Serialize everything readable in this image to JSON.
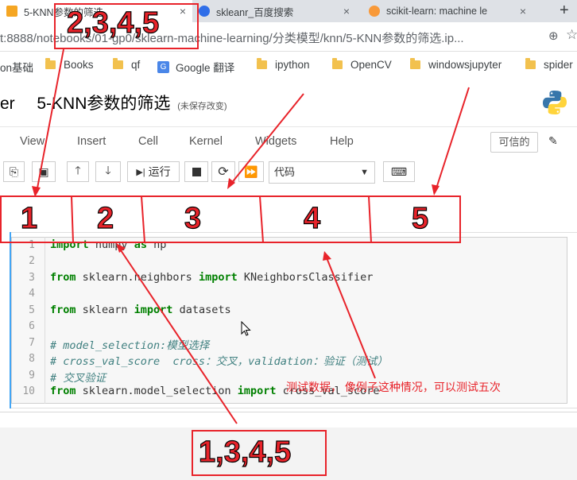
{
  "browser": {
    "tabs": [
      {
        "label": "5-KNN参数的筛选",
        "close": "×"
      },
      {
        "label": "skleanr_百度搜索",
        "close": "×"
      },
      {
        "label": "scikit-learn: machine le",
        "close": "×"
      }
    ],
    "new_tab": "+",
    "url": "t:8888/notebooks/01-gp0/sklearn-machine-learning/分类模型/knn/5-KNN参数的筛选.ip...",
    "bookmarks": [
      "on基础",
      "Books",
      "qf",
      "Google 翻译",
      "ipython",
      "OpenCV",
      "windowsjupyter",
      "spider"
    ]
  },
  "jupyter": {
    "logo_suffix": "er",
    "notebook_name": "5-KNN参数的筛选",
    "save_status": "(未保存改变)",
    "menu": [
      "View",
      "Insert",
      "Cell",
      "Kernel",
      "Widgets",
      "Help"
    ],
    "trusted": "可信的",
    "run_label": "运行",
    "cell_type": "代码"
  },
  "code": {
    "line_numbers": [
      "1",
      "2",
      "3",
      "4",
      "5",
      "6",
      "7",
      "8",
      "9",
      "10"
    ],
    "lines": [
      {
        "kw1": "import",
        "mid": " numpy ",
        "kw2": "as",
        "tail": " np"
      },
      {},
      {
        "kw1": "from",
        "mid": " sklearn.neighbors ",
        "kw2": "import",
        "tail": " KNeighborsClassifier"
      },
      {},
      {
        "kw1": "from",
        "mid": " sklearn ",
        "kw2": "import",
        "tail": " datasets"
      },
      {},
      {
        "comment": "# model_selection:模型选择"
      },
      {
        "comment": "# cross_val_score  cross：交叉，validation：验证（测试）"
      },
      {
        "comment": "# 交叉验证"
      },
      {
        "kw1": "from",
        "mid": " sklearn.model_selection ",
        "kw2": "import",
        "tail": " cross_val_score"
      }
    ]
  },
  "annotations": {
    "top_label": "2,3,4,5",
    "bottom_label": "1,3,4,5",
    "segments": [
      "1",
      "2",
      "3",
      "4",
      "5"
    ],
    "note": "测试数据，  像例子这种情况，可以测试五次"
  },
  "colors": {
    "annotation_red": "#e8232a",
    "keyword_green": "#008000",
    "comment_teal": "#408080",
    "cell_selected_blue": "#42a5f5"
  }
}
